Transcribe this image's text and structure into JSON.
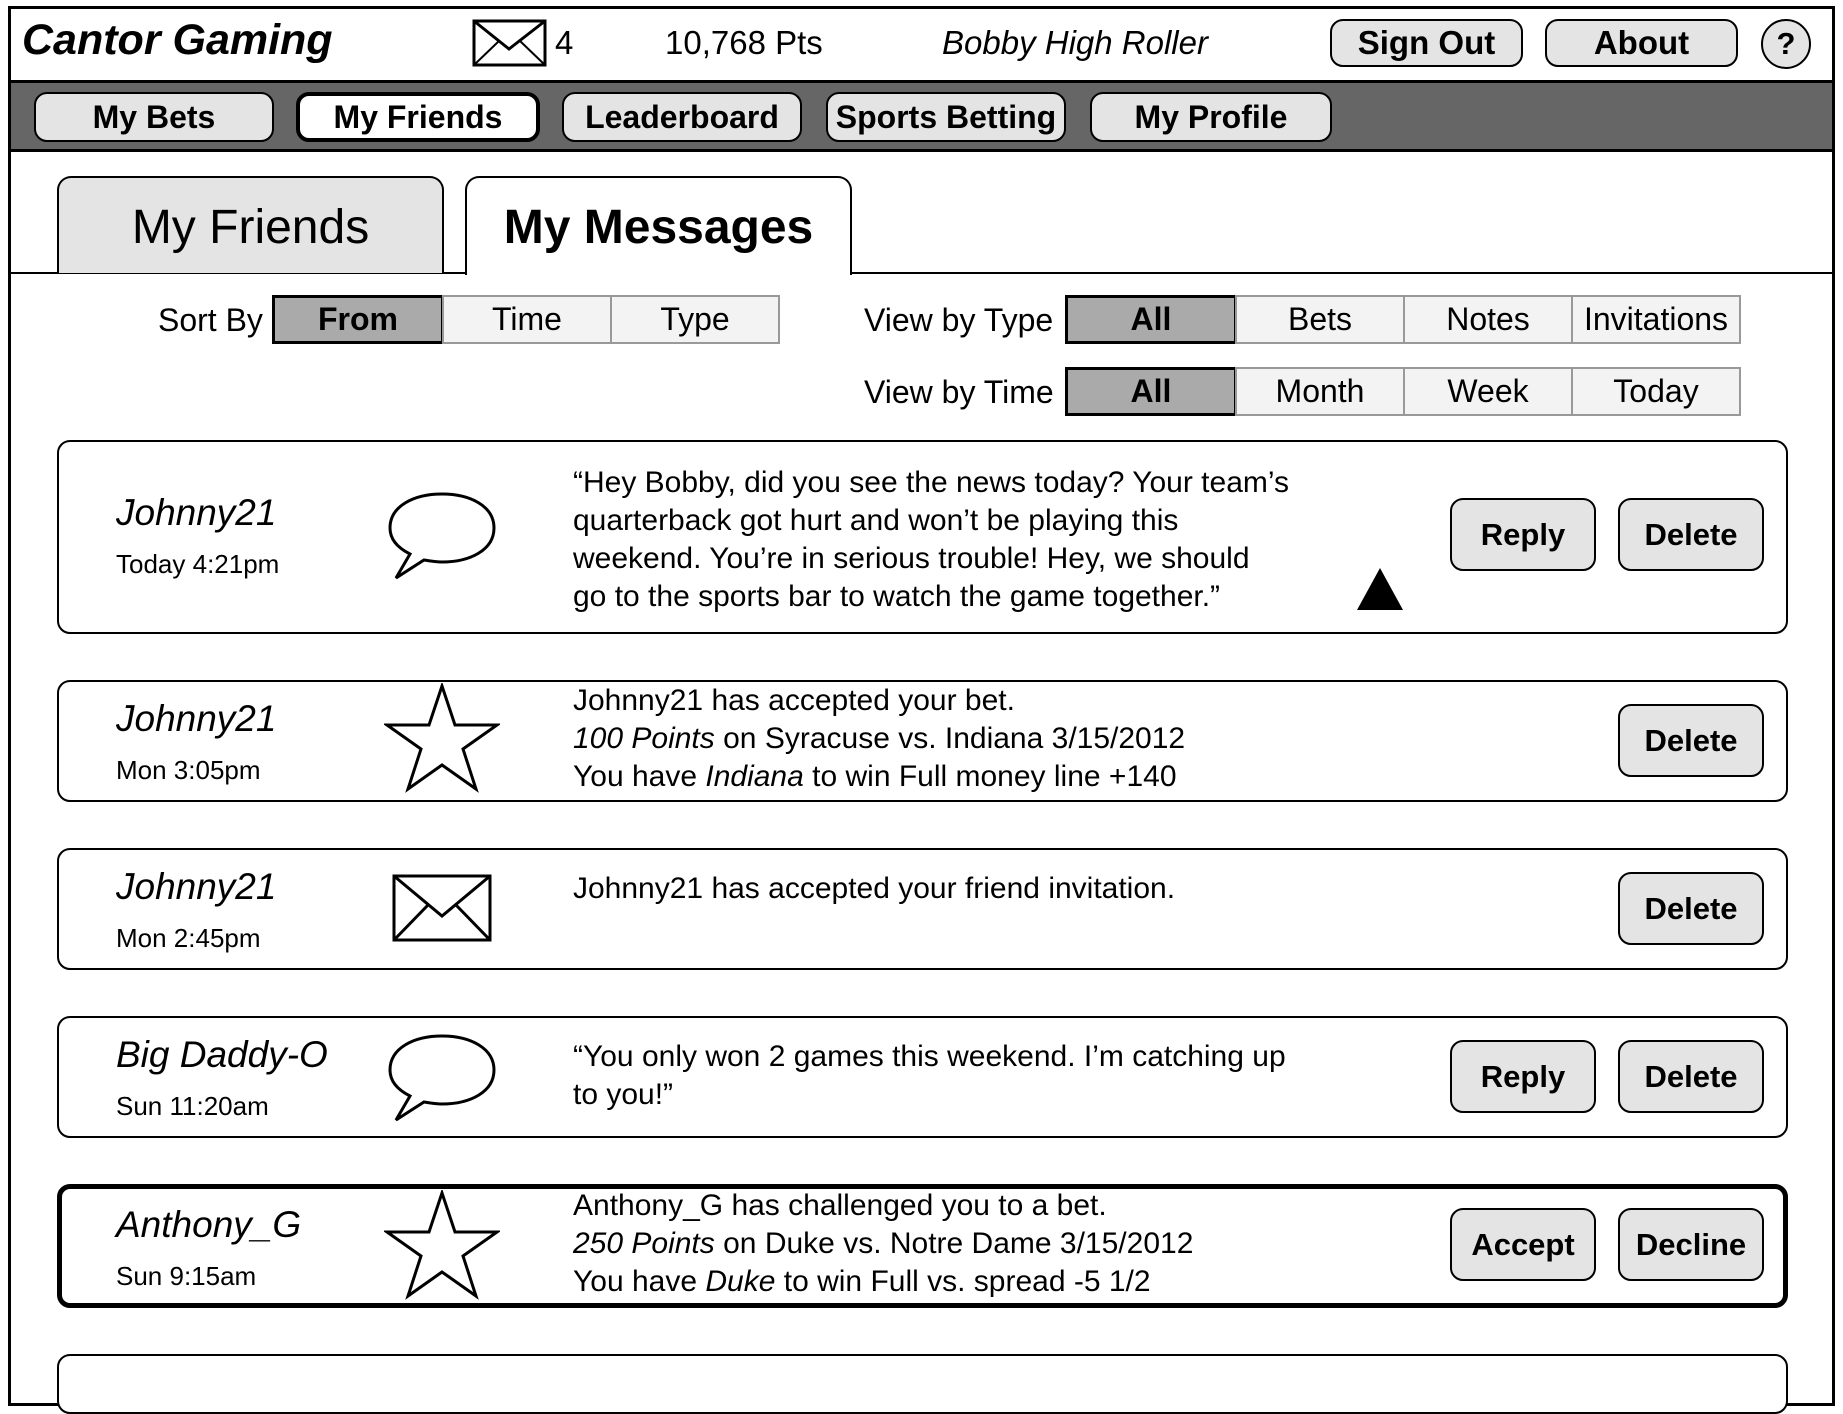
{
  "header": {
    "brand": "Cantor Gaming",
    "mail_count": "4",
    "points": "10,768 Pts",
    "username": "Bobby High Roller",
    "sign_out_label": "Sign Out",
    "about_label": "About",
    "help_label": "?"
  },
  "nav": {
    "items": [
      {
        "label": "My Bets"
      },
      {
        "label": "My Friends"
      },
      {
        "label": "Leaderboard"
      },
      {
        "label": "Sports Betting"
      },
      {
        "label": "My Profile"
      }
    ],
    "active": "My Friends"
  },
  "tabs": {
    "friends": "My Friends",
    "messages": "My Messages"
  },
  "filters": {
    "sort_label": "Sort By",
    "sort_options": [
      "From",
      "Time",
      "Type"
    ],
    "sort_selected": "From",
    "type_label": "View by Type",
    "type_options": [
      "All",
      "Bets",
      "Notes",
      "Invitations"
    ],
    "type_selected": "All",
    "time_label": "View by Time",
    "time_options": [
      "All",
      "Month",
      "Week",
      "Today"
    ],
    "time_selected": "All"
  },
  "messages": [
    {
      "sender": "Johnny21",
      "time": "Today 4:21pm",
      "icon": "speech-bubble-icon",
      "lines": [
        "“Hey Bobby, did you see the news today? Your team’s",
        "quarterback got hurt and won’t be playing this",
        "weekend. You’re in serious trouble! Hey, we should",
        "go to the sports bar to watch the game together.”"
      ],
      "actions": [
        "Reply",
        "Delete"
      ]
    },
    {
      "sender": "Johnny21",
      "time": "Mon 3:05pm",
      "icon": "star-icon",
      "line1": "Johnny21 has accepted your bet.",
      "line2_em": "100 Points",
      "line2_rest": " on Syracuse vs. Indiana 3/15/2012",
      "line3_pre": "You have ",
      "line3_em": "Indiana",
      "line3_post": " to win Full money line +140",
      "actions": [
        "Delete"
      ]
    },
    {
      "sender": "Johnny21",
      "time": "Mon 2:45pm",
      "icon": "envelope-icon",
      "line1": "Johnny21 has accepted your friend invitation.",
      "actions": [
        "Delete"
      ]
    },
    {
      "sender": "Big Daddy-O",
      "time": "Sun 11:20am",
      "icon": "speech-bubble-icon",
      "lines": [
        "“You only won 2 games this weekend. I’m catching up",
        "to you!”"
      ],
      "actions": [
        "Reply",
        "Delete"
      ]
    },
    {
      "sender": "Anthony_G",
      "time": "Sun 9:15am",
      "icon": "star-icon",
      "line1": "Anthony_G has challenged you to a bet.",
      "line2_em": "250 Points",
      "line2_rest": " on Duke vs. Notre Dame 3/15/2012",
      "line3_pre": "You have ",
      "line3_em": "Duke",
      "line3_post": " to win Full vs. spread -5 1/2",
      "actions": [
        "Accept",
        "Decline"
      ]
    }
  ]
}
